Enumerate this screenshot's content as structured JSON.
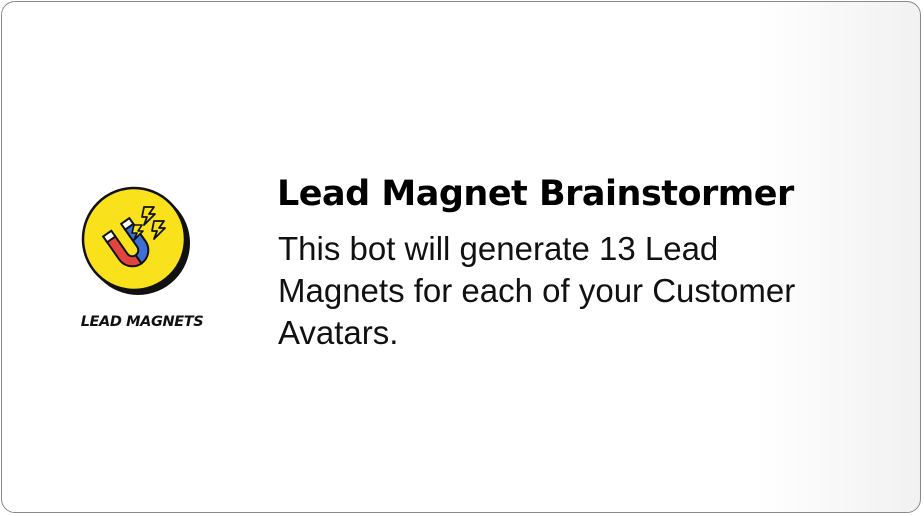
{
  "card": {
    "title": "Lead Magnet Brainstormer",
    "description_lines": [
      "This bot will generate 13 Lead",
      "Magnets for each of your Customer",
      "Avatars."
    ]
  },
  "logo": {
    "text": "LEAD MAGNETS",
    "icon": "magnet-icon",
    "colors": {
      "circle": "#f9e21b",
      "outline": "#111111",
      "magnet_red": "#e2453d",
      "magnet_blue": "#3d6fd6"
    }
  }
}
